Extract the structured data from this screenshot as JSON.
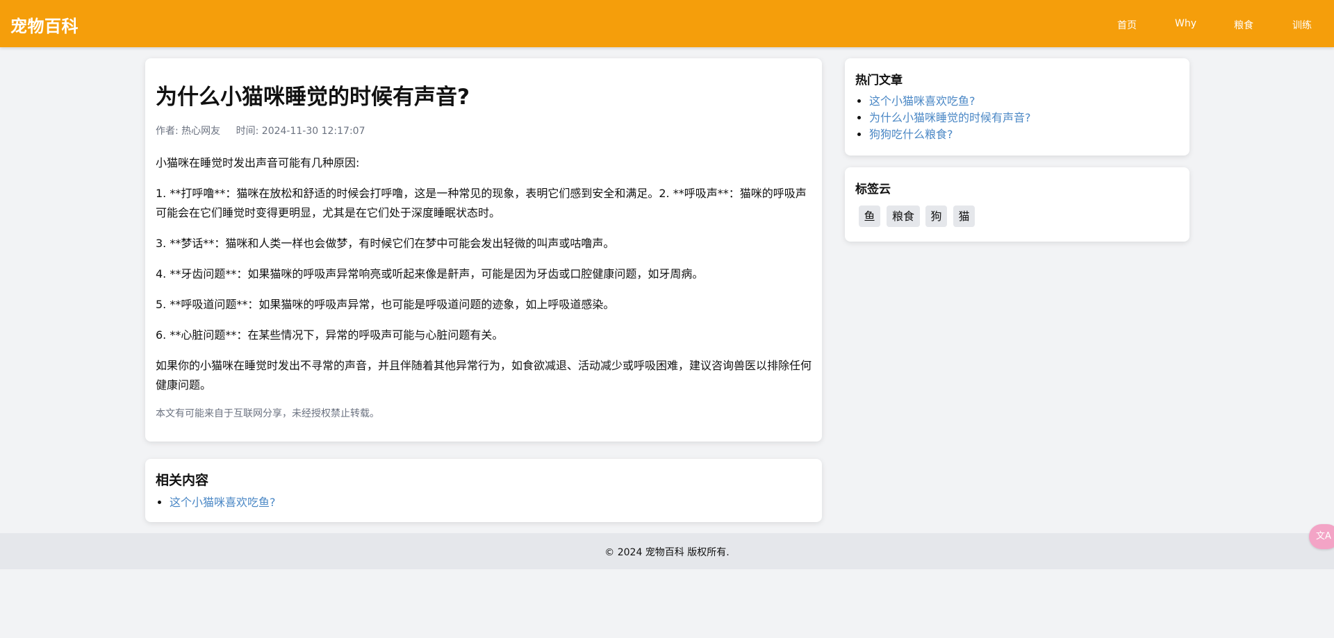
{
  "header": {
    "brand": "宠物百科",
    "nav": [
      "首页",
      "Why",
      "粮食",
      "训练"
    ]
  },
  "article": {
    "title": "为什么小猫咪睡觉的时候有声音?",
    "author": "作者: 热心网友",
    "time": "时间: 2024-11-30 12:17:07",
    "paragraphs": [
      "小猫咪在睡觉时发出声音可能有几种原因:",
      "1. **打呼噜**：猫咪在放松和舒适的时候会打呼噜，这是一种常见的现象，表明它们感到安全和满足。2. **呼吸声**：猫咪的呼吸声可能会在它们睡觉时变得更明显，尤其是在它们处于深度睡眠状态时。",
      "3. **梦话**：猫咪和人类一样也会做梦，有时候它们在梦中可能会发出轻微的叫声或咕噜声。",
      "4. **牙齿问题**：如果猫咪的呼吸声异常响亮或听起来像是鼾声，可能是因为牙齿或口腔健康问题，如牙周病。",
      "5. **呼吸道问题**：如果猫咪的呼吸声异常，也可能是呼吸道问题的迹象，如上呼吸道感染。",
      "6. **心脏问题**：在某些情况下，异常的呼吸声可能与心脏问题有关。",
      "如果你的小猫咪在睡觉时发出不寻常的声音，并且伴随着其他异常行为，如食欲减退、活动减少或呼吸困难，建议咨询兽医以排除任何健康问题。"
    ],
    "notice": "本文有可能来自于互联网分享，未经授权禁止转载。"
  },
  "related": {
    "title": "相关内容",
    "items": [
      "这个小猫咪喜欢吃鱼?"
    ]
  },
  "hot": {
    "title": "热门文章",
    "items": [
      "这个小猫咪喜欢吃鱼?",
      "为什么小猫咪睡觉的时候有声音?",
      "狗狗吃什么粮食?"
    ]
  },
  "tags": {
    "title": "标签云",
    "items": [
      "鱼",
      "粮食",
      "狗",
      "猫"
    ]
  },
  "footer": {
    "text": "© 2024 宠物百科 版权所有."
  },
  "translate": {
    "icon": "translate-icon",
    "glyph": "文A"
  },
  "colors": {
    "header": "#f59e0b",
    "link": "#4a87c5"
  }
}
